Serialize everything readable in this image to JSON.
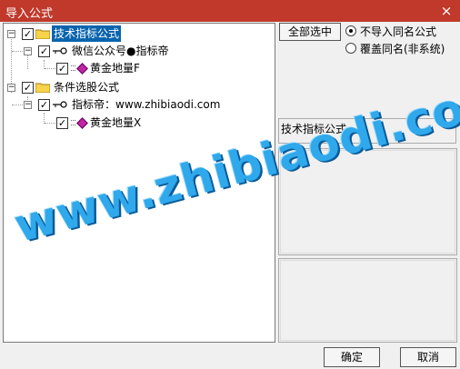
{
  "window": {
    "title": "导入公式",
    "close_glyph": "×"
  },
  "tree": {
    "root1": {
      "label": "技术指标公式",
      "expander": "−",
      "check": "✓"
    },
    "child1": {
      "label": "微信公众号●指标帝",
      "expander": "−",
      "check": "✓"
    },
    "leaf1": {
      "label": "黄金地量F",
      "check": "✓"
    },
    "root2": {
      "label": "条件选股公式",
      "expander": "−",
      "check": "✓"
    },
    "child2": {
      "label": "指标帝：www.zhibiaodi.com",
      "expander": "−",
      "check": "✓"
    },
    "leaf2": {
      "label": "黄金地量X",
      "check": "✓"
    }
  },
  "options": {
    "select_all": "全部选中",
    "radio1": "不导入同名公式",
    "radio2": "覆盖同名(非系统)"
  },
  "panel": {
    "category_label": "技术指标公式"
  },
  "buttons": {
    "ok": "确定",
    "cancel": "取消"
  },
  "watermark": {
    "text": "www.zhibiaodi.com"
  },
  "colors": {
    "titlebar": "#c0392b",
    "selection": "#0a64ad",
    "watermark": "#2fa8ec"
  }
}
